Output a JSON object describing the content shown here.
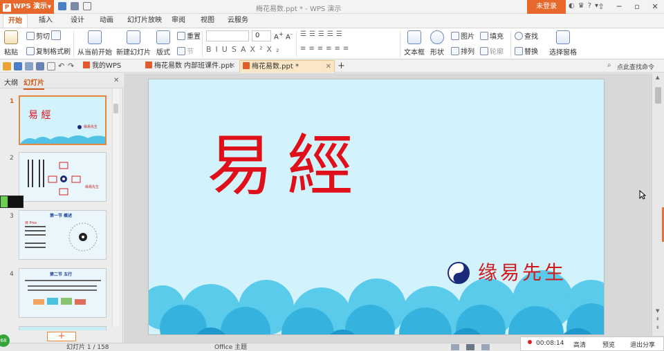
{
  "app": {
    "button_label": "WPS 演示",
    "logo": "P",
    "window_title": "梅花易数.ppt * - WPS 演示",
    "login_label": "未登录"
  },
  "ribbon_tabs": [
    "开始",
    "插入",
    "设计",
    "动画",
    "幻灯片放映",
    "审阅",
    "视图",
    "云服务"
  ],
  "ribbon": {
    "paste": "粘贴",
    "cut": "剪切",
    "copy": "复制",
    "format_painter": "格式刷",
    "from_current": "从当前开始",
    "new_slide": "新建幻灯片",
    "layout": "版式",
    "reset": "重置",
    "section": "节",
    "font_size": "0",
    "textbox": "文本框",
    "shape": "形状",
    "arrange": "排列",
    "picture": "图片",
    "fill": "填充",
    "outline": "轮廓",
    "find": "查找",
    "replace": "替换",
    "selection_pane": "选择窗格"
  },
  "doc_tabs": [
    {
      "label": "我的WPS"
    },
    {
      "label": "梅花易数 内部班课件.ppt *"
    },
    {
      "label": "梅花易数.ppt *"
    }
  ],
  "search_command": "点此查找命令",
  "left_pane": {
    "outline_tab": "大纲",
    "slides_tab": "幻灯片",
    "slide_numbers": [
      "1",
      "2",
      "3",
      "4"
    ],
    "add_slide": "+"
  },
  "slide": {
    "title_char1": "易",
    "title_char2": "經",
    "author": "缘易先生"
  },
  "thumbs": {
    "t1_title": "易 經",
    "t1_author": "缘易先生",
    "t2_label": "缘易先生",
    "t3_heading": "第一节 概述",
    "t3_sub": "目 Pros",
    "t4_heading": "第二节 五行"
  },
  "status": {
    "slide_counter": "幻灯片 1 / 158",
    "theme": "Office 主题"
  },
  "recording": {
    "time": "00:08:14",
    "hd": "高清",
    "preview": "预览",
    "exit_share": "退出分享"
  },
  "badge": "68",
  "colors": {
    "accent": "#e8672a",
    "title_red": "#e0101a",
    "slide_bg": "#d2f3fb",
    "cloud_blue": "#3cb6e0",
    "author_red": "#cf1b1b"
  }
}
